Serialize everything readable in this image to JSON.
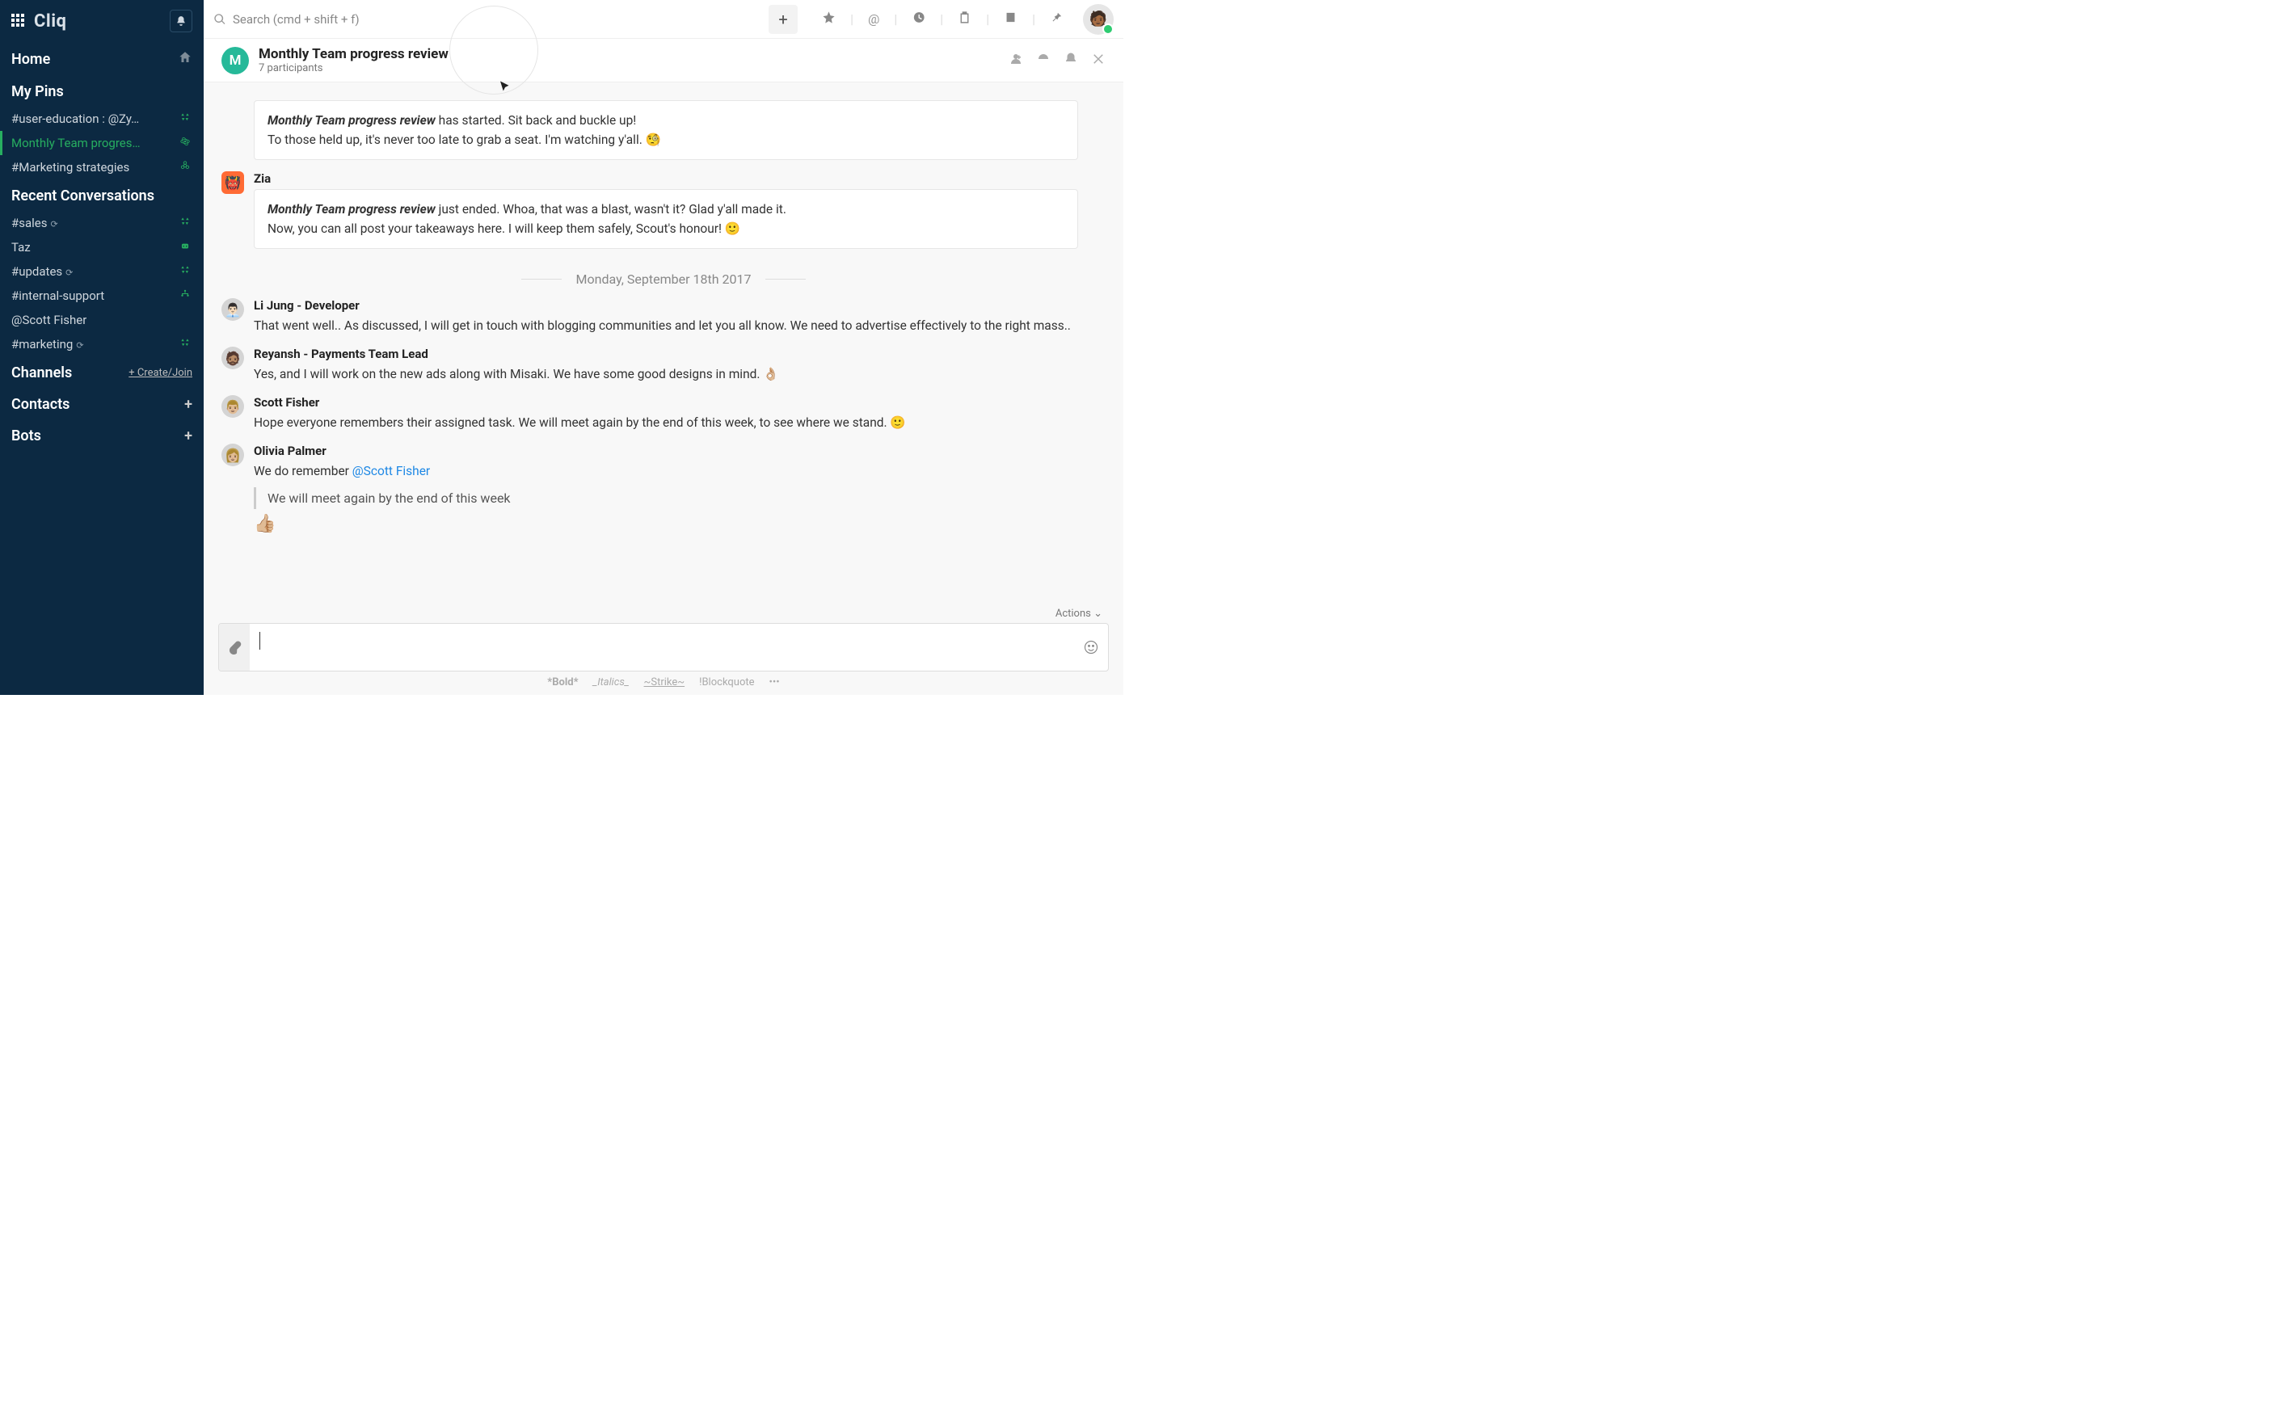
{
  "brand": {
    "name": "Cliq"
  },
  "sidebar": {
    "home": "Home",
    "pins_header": "My Pins",
    "pins": [
      {
        "label": "#user-education : @Zy…",
        "icon": "recycle"
      },
      {
        "label": "Monthly Team progres…",
        "icon": "atom",
        "active": true
      },
      {
        "label": "#Marketing strategies",
        "icon": "biohazard"
      }
    ],
    "recent_header": "Recent Conversations",
    "recent": [
      {
        "label": "#sales",
        "icon": "recycle",
        "loop": true
      },
      {
        "label": "Taz",
        "icon": "bot"
      },
      {
        "label": "#updates",
        "icon": "recycle",
        "loop": true
      },
      {
        "label": "#internal-support",
        "icon": "org"
      },
      {
        "label": "@Scott Fisher",
        "icon": "online"
      },
      {
        "label": "#marketing",
        "icon": "recycle",
        "loop": true
      }
    ],
    "channels_header": "Channels",
    "channels_action": "+ Create/Join",
    "contacts_header": "Contacts",
    "bots_header": "Bots"
  },
  "search": {
    "placeholder": "Search (cmd + shift + f)"
  },
  "channel": {
    "avatar_initial": "M",
    "title": "Monthly Team progress review",
    "subtitle": "7 participants"
  },
  "messages": [
    {
      "sender": "",
      "bubble": true,
      "avatar_hidden_pin": true,
      "lines": [
        {
          "html": "<em>Monthly Team progress review</em> has started. Sit back and buckle up!"
        },
        {
          "html": "To those held up, it's never too late to grab a seat. I'm watching y'all. 🧐"
        }
      ]
    },
    {
      "sender": "Zia",
      "avatar_color": "av-lime",
      "avatar_emoji": "👹",
      "bubble": true,
      "lines": [
        {
          "html": "<em>Monthly Team progress review</em> just ended. Whoa, that was a blast, wasn't it? Glad y'all made it."
        },
        {
          "html": "Now, you can all post your takeaways here. I will keep them safely, Scout's honour! 🙂"
        }
      ]
    }
  ],
  "date_separator": "Monday, September 18th 2017",
  "messages2": [
    {
      "sender": "Li Jung - Developer",
      "text": "That went well.. As discussed, I will get in touch with blogging communities and let you all know. We need to advertise effectively to the right mass..",
      "av_emoji": "👨🏻‍💼"
    },
    {
      "sender": "Reyansh - Payments Team Lead",
      "text": "Yes, and I will work on the new ads along with Misaki. We have some good designs in mind.  👌🏼",
      "av_emoji": "🧔🏽"
    },
    {
      "sender": "Scott Fisher",
      "text": "Hope everyone remembers their assigned task. We will meet again by the end of this week, to see where we stand.  🙂",
      "av_emoji": "👨🏼"
    },
    {
      "sender": "Olivia Palmer",
      "av_emoji": "👩🏼",
      "parts": {
        "pre": "We do remember ",
        "mention": "@Scott Fisher",
        "quote": "We will meet again by the end of this week",
        "reaction": "👍🏼"
      }
    }
  ],
  "composer": {
    "actions": "Actions",
    "placeholder": ""
  },
  "format_hints": {
    "bold": "*Bold*",
    "italics": "_Italics_",
    "strike": "~Strike~",
    "block": "!Blockquote",
    "more": "•••"
  }
}
